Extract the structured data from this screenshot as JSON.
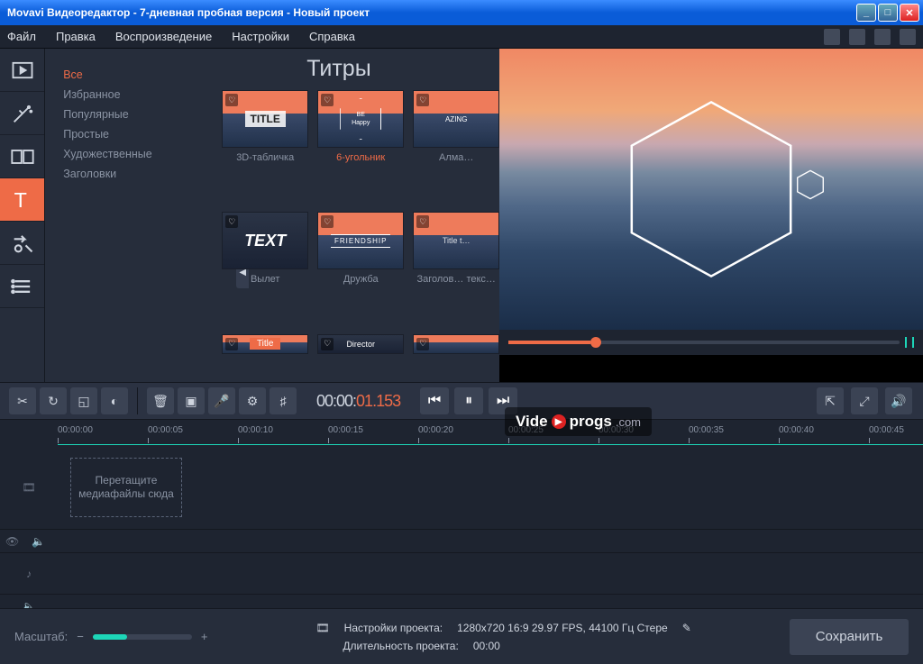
{
  "window": {
    "title": "Movavi Видеоредактор - 7-дневная пробная версия - Новый проект"
  },
  "menu": {
    "file": "Файл",
    "edit": "Правка",
    "playback": "Воспроизведение",
    "settings": "Настройки",
    "help": "Справка"
  },
  "panel": {
    "title": "Титры",
    "categories": [
      "Все",
      "Избранное",
      "Популярные",
      "Простые",
      "Художественные",
      "Заголовки"
    ],
    "selected_category_index": 0,
    "items": [
      {
        "label": "3D-табличка",
        "thumb_text": "TITLE",
        "selected": false
      },
      {
        "label": "6-угольник",
        "thumb_text": "Be Happy",
        "selected": true
      },
      {
        "label": "Алма…",
        "thumb_text": "AZING",
        "selected": false
      },
      {
        "label": "Вылет",
        "thumb_text": "TEXT",
        "selected": false
      },
      {
        "label": "Дружба",
        "thumb_text": "FRIENDSHIP",
        "selected": false
      },
      {
        "label": "Заголов… текс…",
        "thumb_text": "Title t…",
        "selected": false
      },
      {
        "label": "",
        "thumb_text": "Title",
        "selected": false
      },
      {
        "label": "",
        "thumb_text": "Director",
        "selected": false
      },
      {
        "label": "",
        "thumb_text": "",
        "selected": false
      }
    ]
  },
  "preview": {
    "timecode_gray": "00:00:",
    "timecode_orange": "01.153",
    "scrub_percent": 21
  },
  "ruler": [
    "00:00:00",
    "00:00:05",
    "00:00:10",
    "00:00:15",
    "00:00:20",
    "00:00:25",
    "00:00:30",
    "00:00:35",
    "00:00:40",
    "00:00:45"
  ],
  "dropzone": "Перетащите медиафайлы сюда",
  "watermark": {
    "pre": "Vide",
    "post": "progs",
    "ext": ".com"
  },
  "bottom": {
    "zoom_label": "Масштаб:",
    "project_settings_label": "Настройки проекта:",
    "project_settings_value": "1280x720 16:9 29.97 FPS, 44100 Гц Стере",
    "duration_label": "Длительность проекта:",
    "duration_value": "00:00",
    "save": "Сохранить"
  }
}
